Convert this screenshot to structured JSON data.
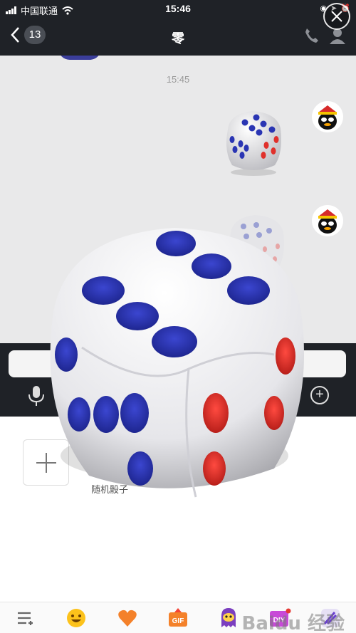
{
  "status": {
    "carrier": "中国联通",
    "time": "15:46"
  },
  "nav": {
    "back_count": "13",
    "title": "零"
  },
  "chat": {
    "timestamp": "15:45"
  },
  "panel": {
    "dice_label": "随机骰子"
  },
  "tabs": {
    "gif_label": "GIF",
    "diy_label": "DIY"
  },
  "watermark": "Baidu 经验",
  "colors": {
    "dark_bar": "#1f2227",
    "dice_blue": "#2a35b3",
    "dice_red": "#e0302b",
    "chat_bg": "#e9e9ea"
  },
  "icons": [
    "wifi-icon",
    "back-chevron-icon",
    "phone-icon",
    "profile-icon",
    "close-icon",
    "mic-icon",
    "plus-icon",
    "list-icon",
    "emoji-icon",
    "heart-icon",
    "gif-icon",
    "ghost-icon",
    "diy-icon",
    "brush-icon"
  ]
}
